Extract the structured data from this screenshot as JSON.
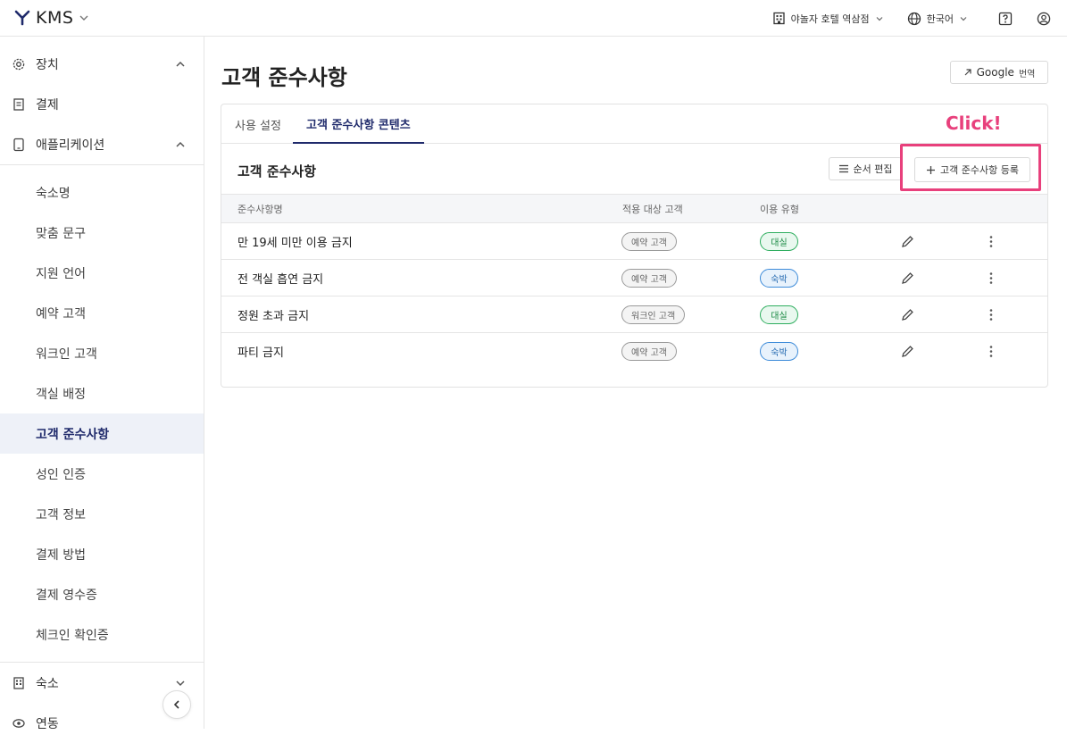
{
  "topbar": {
    "brand": "KMS",
    "hotel": "야놀자 호텔 역삼점",
    "language": "한국어"
  },
  "sidebar": {
    "sections_top": [
      {
        "label": "장치",
        "icon": "gear-icon",
        "expanded": false
      },
      {
        "label": "결제",
        "icon": "receipt-icon"
      },
      {
        "label": "애플리케이션",
        "icon": "tablet-icon",
        "expanded": true
      }
    ],
    "sub_items": [
      {
        "label": "숙소명"
      },
      {
        "label": "맞춤 문구"
      },
      {
        "label": "지원 언어"
      },
      {
        "label": "예약 고객"
      },
      {
        "label": "워크인 고객"
      },
      {
        "label": "객실 배정"
      },
      {
        "label": "고객 준수사항",
        "active": true
      },
      {
        "label": "성인 인증"
      },
      {
        "label": "고객 정보"
      },
      {
        "label": "결제 방법"
      },
      {
        "label": "결제 영수증"
      },
      {
        "label": "체크인 확인증"
      }
    ],
    "sections_bottom": [
      {
        "label": "숙소",
        "icon": "building-icon"
      },
      {
        "label": "연동",
        "icon": "link-icon"
      }
    ]
  },
  "main": {
    "title": "고객 준수사항",
    "google_translate": {
      "brand": "Google",
      "label": "번역"
    },
    "tabs": [
      {
        "label": "사용 설정"
      },
      {
        "label": "고객 준수사항 콘텐츠",
        "active": true
      }
    ],
    "annotation": "Click!",
    "section_title": "고객 준수사항",
    "order_edit_label": "순서 편집",
    "add_label": "고객 준수사항 등록",
    "table": {
      "headers": [
        "준수사항명",
        "적용 대상 고객",
        "이용 유형"
      ],
      "rows": [
        {
          "name": "만 19세 미만 이용 금지",
          "target": "예약 고객",
          "type": "대실",
          "type_color": "green"
        },
        {
          "name": "전 객실 흡연 금지",
          "target": "예약 고객",
          "type": "숙박",
          "type_color": "blue"
        },
        {
          "name": "정원 초과 금지",
          "target": "워크인 고객",
          "type": "대실",
          "type_color": "green"
        },
        {
          "name": "파티 금지",
          "target": "예약 고객",
          "type": "숙박",
          "type_color": "blue"
        }
      ]
    }
  },
  "colors": {
    "accent": "#1f2a6b",
    "highlight": "#e8407c",
    "green": "#2fae5f",
    "blue": "#3d8bd9"
  }
}
